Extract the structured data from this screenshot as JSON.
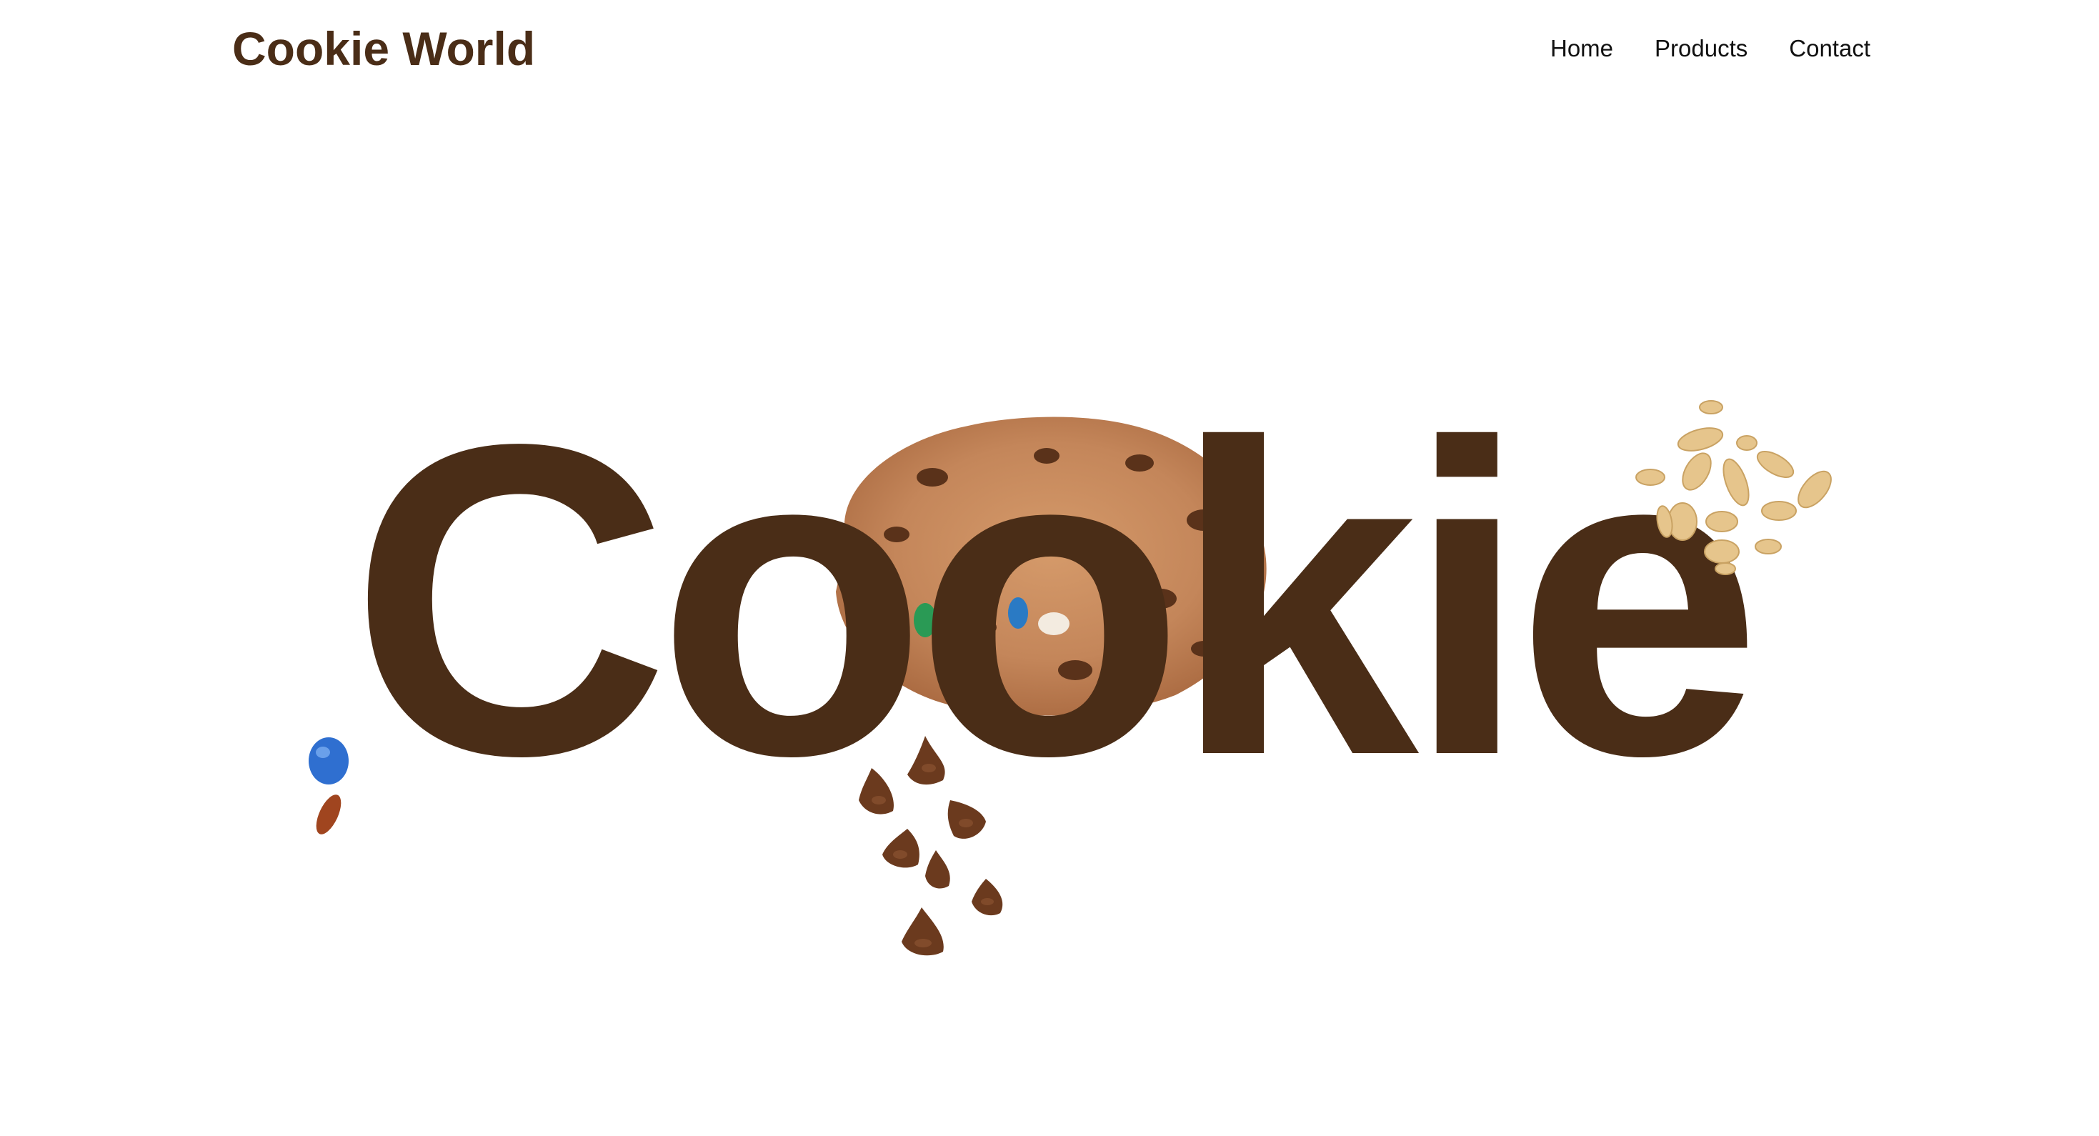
{
  "header": {
    "logo": "Cookie World",
    "nav": {
      "home": "Home",
      "products": "Products",
      "contact": "Contact"
    }
  },
  "hero": {
    "title": "Cookie"
  },
  "colors": {
    "brand": "#4a2d17",
    "background": "#ffffff",
    "nav_text": "#111111"
  },
  "icons": [
    "cookie-image",
    "candy-icon",
    "peanuts-icon",
    "chocolate-chips-icon"
  ]
}
